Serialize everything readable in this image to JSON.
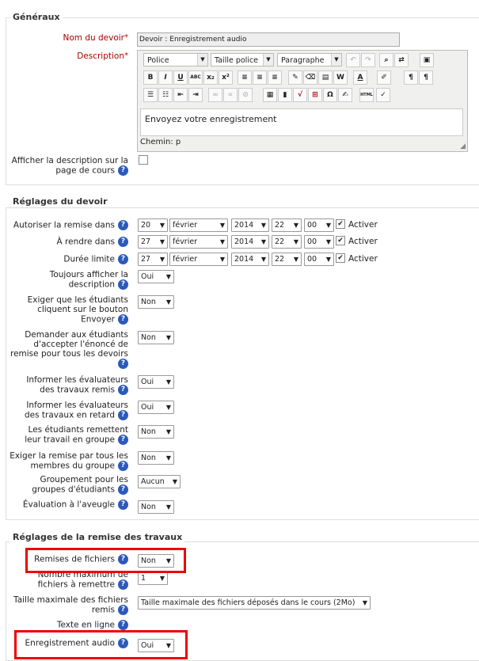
{
  "sections": {
    "general": "Généraux",
    "assign": "Réglages du devoir",
    "submission": "Réglages de la remise des travaux"
  },
  "name": {
    "label": "Nom du devoir",
    "value": "Devoir : Enregistrement audio"
  },
  "description": {
    "label": "Description",
    "font": "Police",
    "size": "Taille police",
    "format": "Paragraphe",
    "content": "Envoyez votre enregistrement",
    "path": "Chemin: p"
  },
  "show_desc": {
    "label": "Afficher la description sur la page de cours"
  },
  "dates": [
    {
      "label": "Autoriser la remise dans",
      "day": "20",
      "month": "février",
      "year": "2014",
      "hour": "22",
      "min": "00",
      "enable": "Activer"
    },
    {
      "label": "À rendre dans",
      "day": "27",
      "month": "février",
      "year": "2014",
      "hour": "22",
      "min": "00",
      "enable": "Activer"
    },
    {
      "label": "Durée limite",
      "day": "27",
      "month": "février",
      "year": "2014",
      "hour": "22",
      "min": "00",
      "enable": "Activer"
    }
  ],
  "settings": [
    {
      "label": "Toujours afficher la description",
      "value": "Oui"
    },
    {
      "label": "Exiger que les étudiants cliquent sur le bouton Envoyer",
      "value": "Non"
    },
    {
      "label": "Demander aux étudiants d'accepter l'énoncé de remise pour tous les devoirs",
      "value": "Non"
    },
    {
      "label": "Informer les évaluateurs des travaux remis",
      "value": "Oui"
    },
    {
      "label": "Informer les évaluateurs des travaux en retard",
      "value": "Oui"
    },
    {
      "label": "Les étudiants remettent leur travail en groupe",
      "value": "Non"
    },
    {
      "label": "Exiger la remise par tous les membres du groupe",
      "value": "Non"
    },
    {
      "label": "Groupement pour les groupes d'étudiants",
      "value": "Aucun"
    },
    {
      "label": "Évaluation à l'aveugle",
      "value": "Non"
    }
  ],
  "submission": [
    {
      "label": "Remises de fichiers",
      "value": "Non"
    },
    {
      "label": "Nombre maximum de fichiers à remettre",
      "value": "1"
    },
    {
      "label": "Taille maximale des fichiers remis",
      "value": "Taille maximale des fichiers déposés dans le cours (2Mo)"
    },
    {
      "label": "Texte en ligne",
      "value": ""
    },
    {
      "label": "Enregistrement audio",
      "value": "Oui"
    }
  ],
  "help_glyph": "?",
  "required_glyph": "*"
}
